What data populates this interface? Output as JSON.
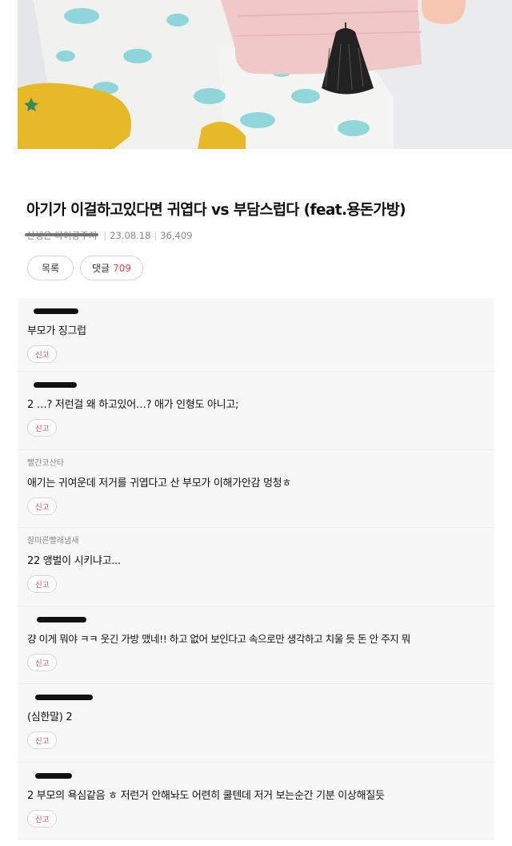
{
  "post": {
    "title": "아기가 이걸하고있다면 귀엽다 vs 부담스럽다 (feat.용돈가방)",
    "author": "선생은 타이공주지",
    "date": "23.08.18",
    "views": "36,409"
  },
  "actions": {
    "list_label": "목록",
    "comments_label": "댓글",
    "comments_count": "709"
  },
  "report_label": "신고",
  "comments": [
    {
      "nick": "",
      "text": "부모가 징그럽"
    },
    {
      "nick": "",
      "text": "2 …? 저런걸 왜 하고있어…? 애가 인형도 아니고;"
    },
    {
      "nick": "빨간코산타",
      "text": "애기는 귀여운데 저거를 귀엽다고 산 부모가 이해가안감 멍청ㅎ"
    },
    {
      "nick": "잘마른빨래냄새",
      "text": "22 앵벌이 시키냐고..."
    },
    {
      "nick": "",
      "text": "걍 이게 뭐야 ㅋㅋ 웃긴 가방 맸네!! 하고 없어 보인다고 속으로만 생각하고 치울 듯 돈 안 주지 뭐"
    },
    {
      "nick": "",
      "text": "(심한말) 2"
    },
    {
      "nick": "",
      "text": "2 부모의 욕심같음 ㅎ 저런거 안해놔도 어련히 쿨텐데 저거 보는순간 기분 이상해질듯"
    }
  ],
  "colors": {
    "accent_red": "#e8474c",
    "comment_bg": "#f7f7f7"
  }
}
